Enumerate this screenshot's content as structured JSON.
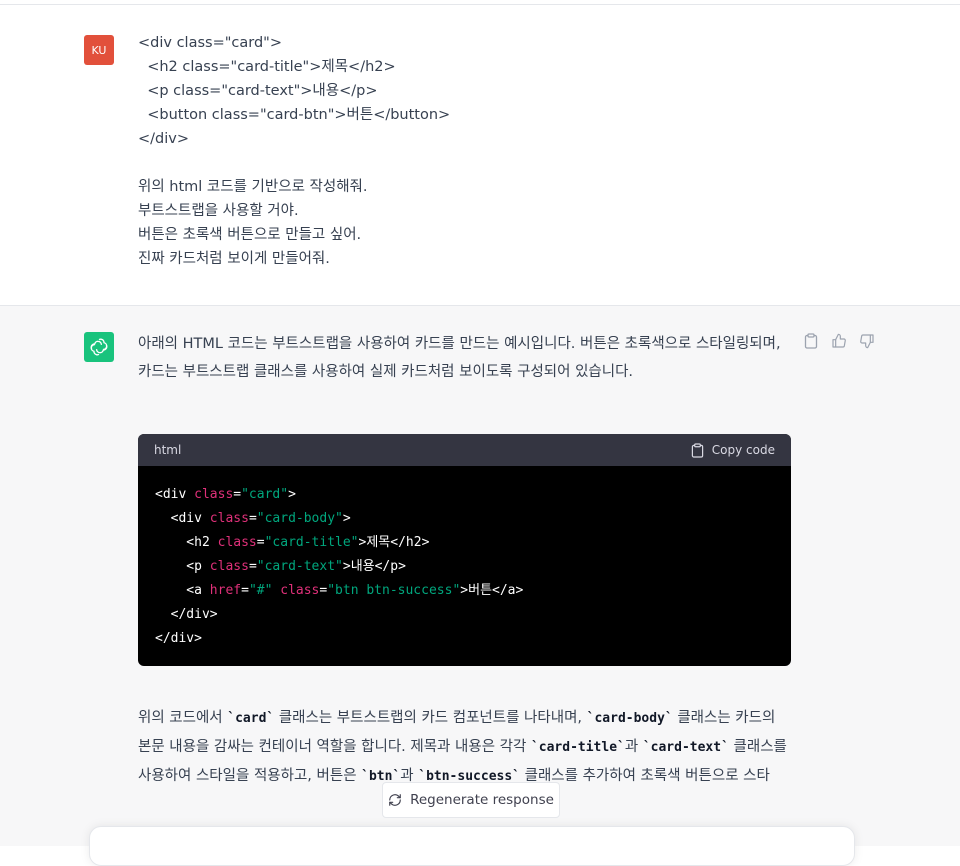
{
  "user_message": {
    "avatar_label": "KU",
    "lines": [
      "<div class=\"card\">",
      "  <h2 class=\"card-title\">제목</h2>",
      "  <p class=\"card-text\">내용</p>",
      "  <button class=\"card-btn\">버튼</button>",
      "</div>",
      "",
      "위의 html 코드를 기반으로 작성해줘.",
      "부트스트랩을 사용할 거야.",
      "버튼은 초록색 버튼으로 만들고 싶어.",
      "진짜 카드처럼 보이게 만들어줘."
    ]
  },
  "assistant_message": {
    "intro": "아래의 HTML 코드는 부트스트랩을 사용하여 카드를 만드는 예시입니다. 버튼은 초록색으로 스타일링되며, 카드는 부트스트랩 클래스를 사용하여 실제 카드처럼 보이도록 구성되어 있습니다.",
    "code_block": {
      "language": "html",
      "copy_label": "Copy code",
      "lines": [
        [
          {
            "t": "tag",
            "v": "<div "
          },
          {
            "t": "attr",
            "v": "class"
          },
          {
            "t": "tag",
            "v": "="
          },
          {
            "t": "str",
            "v": "\"card\""
          },
          {
            "t": "tag",
            "v": ">"
          }
        ],
        [
          {
            "t": "tag",
            "v": "  <div "
          },
          {
            "t": "attr",
            "v": "class"
          },
          {
            "t": "tag",
            "v": "="
          },
          {
            "t": "str",
            "v": "\"card-body\""
          },
          {
            "t": "tag",
            "v": ">"
          }
        ],
        [
          {
            "t": "tag",
            "v": "    <h2 "
          },
          {
            "t": "attr",
            "v": "class"
          },
          {
            "t": "tag",
            "v": "="
          },
          {
            "t": "str",
            "v": "\"card-title\""
          },
          {
            "t": "tag",
            "v": ">"
          },
          {
            "t": "txt",
            "v": "제목"
          },
          {
            "t": "tag",
            "v": "</h2>"
          }
        ],
        [
          {
            "t": "tag",
            "v": "    <p "
          },
          {
            "t": "attr",
            "v": "class"
          },
          {
            "t": "tag",
            "v": "="
          },
          {
            "t": "str",
            "v": "\"card-text\""
          },
          {
            "t": "tag",
            "v": ">"
          },
          {
            "t": "txt",
            "v": "내용"
          },
          {
            "t": "tag",
            "v": "</p>"
          }
        ],
        [
          {
            "t": "tag",
            "v": "    <a "
          },
          {
            "t": "attr",
            "v": "href"
          },
          {
            "t": "tag",
            "v": "="
          },
          {
            "t": "str",
            "v": "\"#\""
          },
          {
            "t": "tag",
            "v": " "
          },
          {
            "t": "attr",
            "v": "class"
          },
          {
            "t": "tag",
            "v": "="
          },
          {
            "t": "str",
            "v": "\"btn btn-success\""
          },
          {
            "t": "tag",
            "v": ">"
          },
          {
            "t": "txt",
            "v": "버튼"
          },
          {
            "t": "tag",
            "v": "</a>"
          }
        ],
        [
          {
            "t": "tag",
            "v": "  </div>"
          }
        ],
        [
          {
            "t": "tag",
            "v": "</div>"
          }
        ]
      ]
    },
    "outro_parts": [
      {
        "t": "text",
        "v": "위의 코드에서 "
      },
      {
        "t": "code",
        "v": "`card`"
      },
      {
        "t": "text",
        "v": " 클래스는 부트스트랩의 카드 컴포넌트를 나타내며, "
      },
      {
        "t": "code",
        "v": "`card-body`"
      },
      {
        "t": "text",
        "v": " 클래스는 카드의 본문 내용을 감싸는 컨테이너 역할을 합니다. 제목과 내용은 각각 "
      },
      {
        "t": "code",
        "v": "`card-title`"
      },
      {
        "t": "text",
        "v": "과 "
      },
      {
        "t": "code",
        "v": "`card-text`"
      },
      {
        "t": "text",
        "v": " 클래스를 사용하여 스타일을 적용하고, 버튼은 "
      },
      {
        "t": "code",
        "v": "`btn`"
      },
      {
        "t": "text",
        "v": "과 "
      },
      {
        "t": "code",
        "v": "`btn-success`"
      },
      {
        "t": "text",
        "v": " 클래스를 추가하여 초록색 버튼으로 스타"
      }
    ]
  },
  "regenerate_label": "Regenerate response",
  "icons": {
    "assistant_avatar": "openai-logo-icon",
    "copy": "clipboard-icon",
    "like": "thumbs-up-icon",
    "dislike": "thumbs-down-icon",
    "regenerate": "refresh-icon"
  },
  "colors": {
    "user_avatar": "#e2503b",
    "assistant_avatar": "#19c37d",
    "code_attr": "#df3079",
    "code_string": "#00a67d",
    "code_bg": "#000000",
    "code_header_bg": "#343541",
    "assistant_bg": "#f7f7f8"
  }
}
